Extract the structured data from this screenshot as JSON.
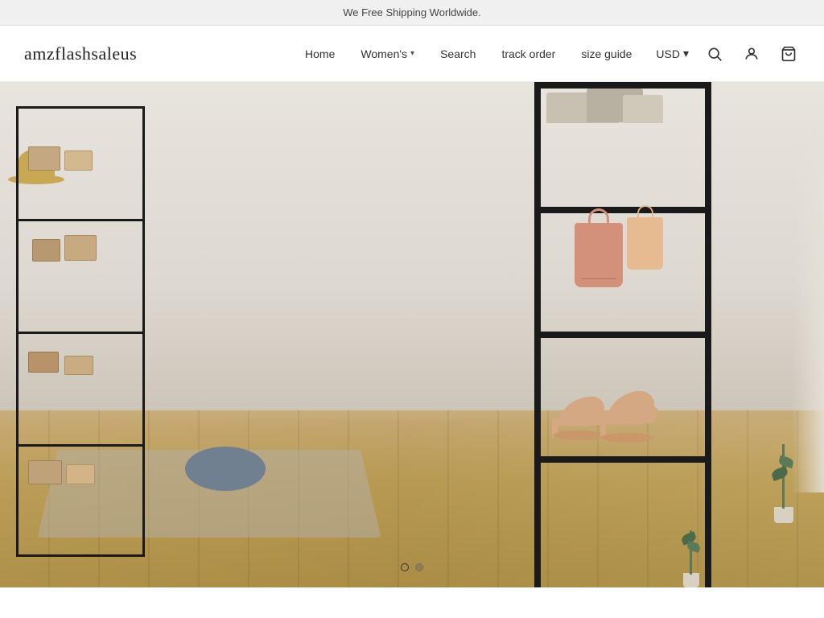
{
  "announcement": {
    "text": "We Free Shipping Worldwide."
  },
  "header": {
    "logo": "amzflashsaleus",
    "nav": {
      "home": "Home",
      "womens": "Women's",
      "search": "Search",
      "track_order": "track order",
      "size_guide": "size guide",
      "currency": "USD"
    }
  },
  "hero": {
    "carousel": {
      "dot1_label": "Slide 1",
      "dot2_label": "Slide 2"
    }
  },
  "icons": {
    "search": "🔍",
    "account": "👤",
    "cart": "🛒",
    "chevron_down": "▾",
    "chevron_currency": "▾"
  }
}
